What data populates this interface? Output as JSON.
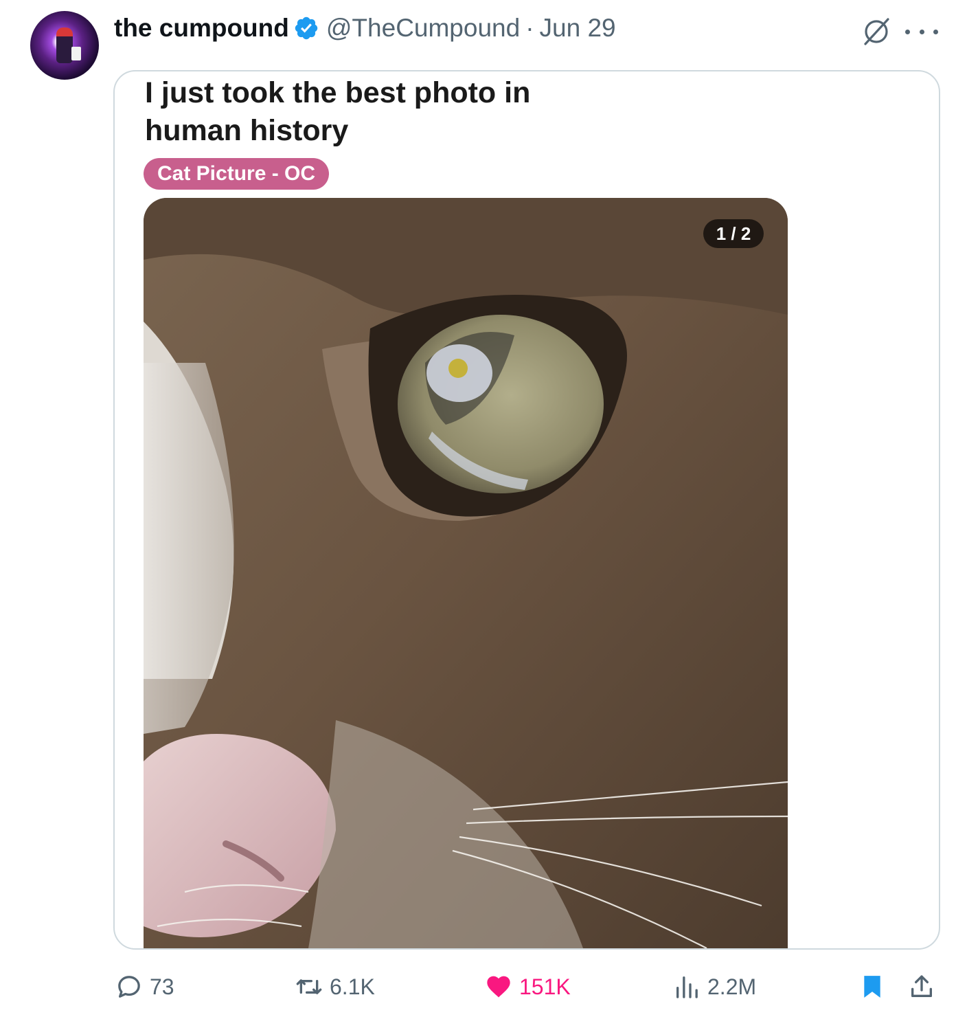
{
  "tweet": {
    "author_name": "the cumpound",
    "author_handle": "@TheCumpound",
    "separator": "·",
    "date": "Jun 29"
  },
  "media": {
    "post_title": "I just took the best photo in human history",
    "flair": "Cat Picture - OC",
    "image_counter": "1 / 2",
    "image_subject": "extreme close-up of a tabby cat's eye"
  },
  "stats": {
    "replies": "73",
    "retweets": "6.1K",
    "likes": "151K",
    "views": "2.2M"
  },
  "colors": {
    "accent_blue": "#1d9bf0",
    "like_pink": "#f91880",
    "flair_pink": "#c85f8d",
    "muted_text": "#536471"
  },
  "icons": [
    "verified-badge-icon",
    "grok-icon",
    "more-icon",
    "reply-icon",
    "retweet-icon",
    "like-heart-icon",
    "views-icon",
    "bookmark-icon",
    "share-icon"
  ]
}
